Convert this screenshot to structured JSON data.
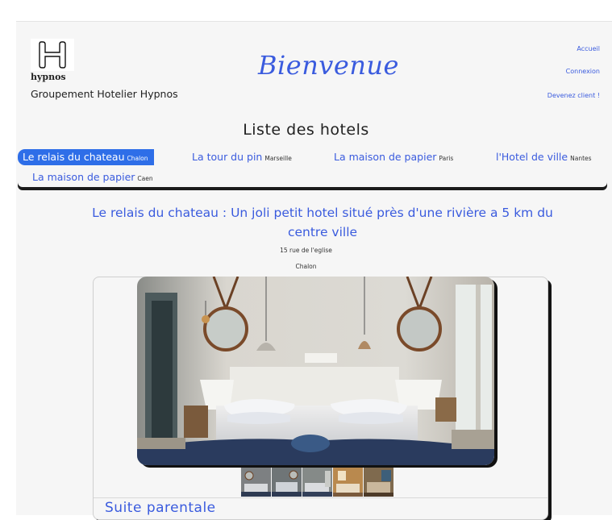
{
  "brand": {
    "logo_text": "hypnos",
    "name": "Groupement Hotelier Hypnos"
  },
  "header": {
    "welcome": "Bienvenue",
    "nav": {
      "home": "Accueil",
      "login": "Connexion",
      "signup": "Devenez client !"
    }
  },
  "hotels_list": {
    "title": "Liste des hotels",
    "tabs": [
      {
        "name": "Le relais du chateau",
        "city": "Chalon"
      },
      {
        "name": "La tour du pin",
        "city": "Marseille"
      },
      {
        "name": "La maison de papier",
        "city": "Paris"
      },
      {
        "name": "l'Hotel de ville",
        "city": "Nantes"
      },
      {
        "name": "La maison de papier",
        "city": "Caen"
      }
    ]
  },
  "hotel": {
    "title": "Le relais du chateau : Un joli petit hotel situé près d'une rivière a 5 km du centre ville",
    "address": "15 rue de l'eglise",
    "city": "Chalon"
  },
  "suite": {
    "title": "Suite parentale"
  },
  "colors": {
    "accent": "#3a5bde",
    "active_tab": "#2e6ee8",
    "background": "#f6f6f6"
  }
}
